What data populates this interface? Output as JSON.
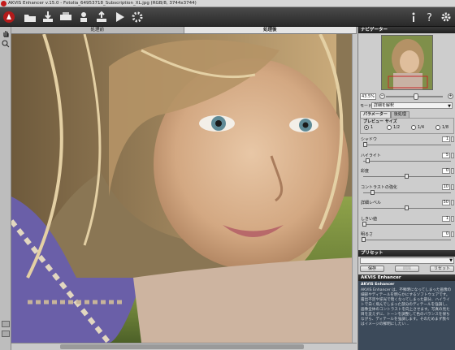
{
  "window": {
    "title": "AKVIS Enhancer v.15.0 - Fotolia_64953718_Subscription_XL.jpg (RGB/8, 3744x3744)"
  },
  "tabs": {
    "before": "処理前",
    "after": "処理後"
  },
  "navigator": {
    "title": "ナビゲーター",
    "zoom": "43.5%"
  },
  "mode": {
    "label": "モード",
    "value": "詳細を解釈"
  },
  "param_tabs": {
    "params": "パラメーター",
    "post": "後処理"
  },
  "preview_size": {
    "label": "プレビュー サイズ",
    "options": [
      "1",
      "1/2",
      "1/4",
      "1/8"
    ],
    "selected": "1"
  },
  "params": [
    {
      "label": "シャドウ",
      "value": "1",
      "fraction": 0.02
    },
    {
      "label": "ハイライト",
      "value": "5",
      "fraction": 0.05
    },
    {
      "label": "彩度",
      "value": "0",
      "fraction": 0.5
    },
    {
      "label": "コントラストの強化",
      "value": "10",
      "fraction": 0.1
    },
    {
      "label": "詳細レベル",
      "value": "50",
      "fraction": 0.5
    },
    {
      "label": "しきい値",
      "value": "1",
      "fraction": 0.01
    },
    {
      "label": "明るさ",
      "value": "0",
      "fraction": 0.0
    }
  ],
  "presets": {
    "label": "プリセット",
    "save": "保存",
    "delete": "削除",
    "reset": "リセット"
  },
  "help": {
    "title": "AKVIS Enhancer",
    "text": "AKVIS Enhancer は、不鮮明になってしまった画像の細部やディテールを明らかにするソフトウェアです。露出不足や逆光で暗くなってしまった部分、ハイライトで白く飛んでしまった部分のディテールを強調し、画像全体のコントラストを向上させます。写真の見た目を変えずに、トーンを調整して色のバランスを保ちながら、ディテールを強調します。そのためまず我々はイメージの鮮明にしたい..."
  },
  "colors": {
    "toolbar": "#333333",
    "panel_header": "#2a2a2a",
    "help_bg": "#3c4a5a"
  }
}
